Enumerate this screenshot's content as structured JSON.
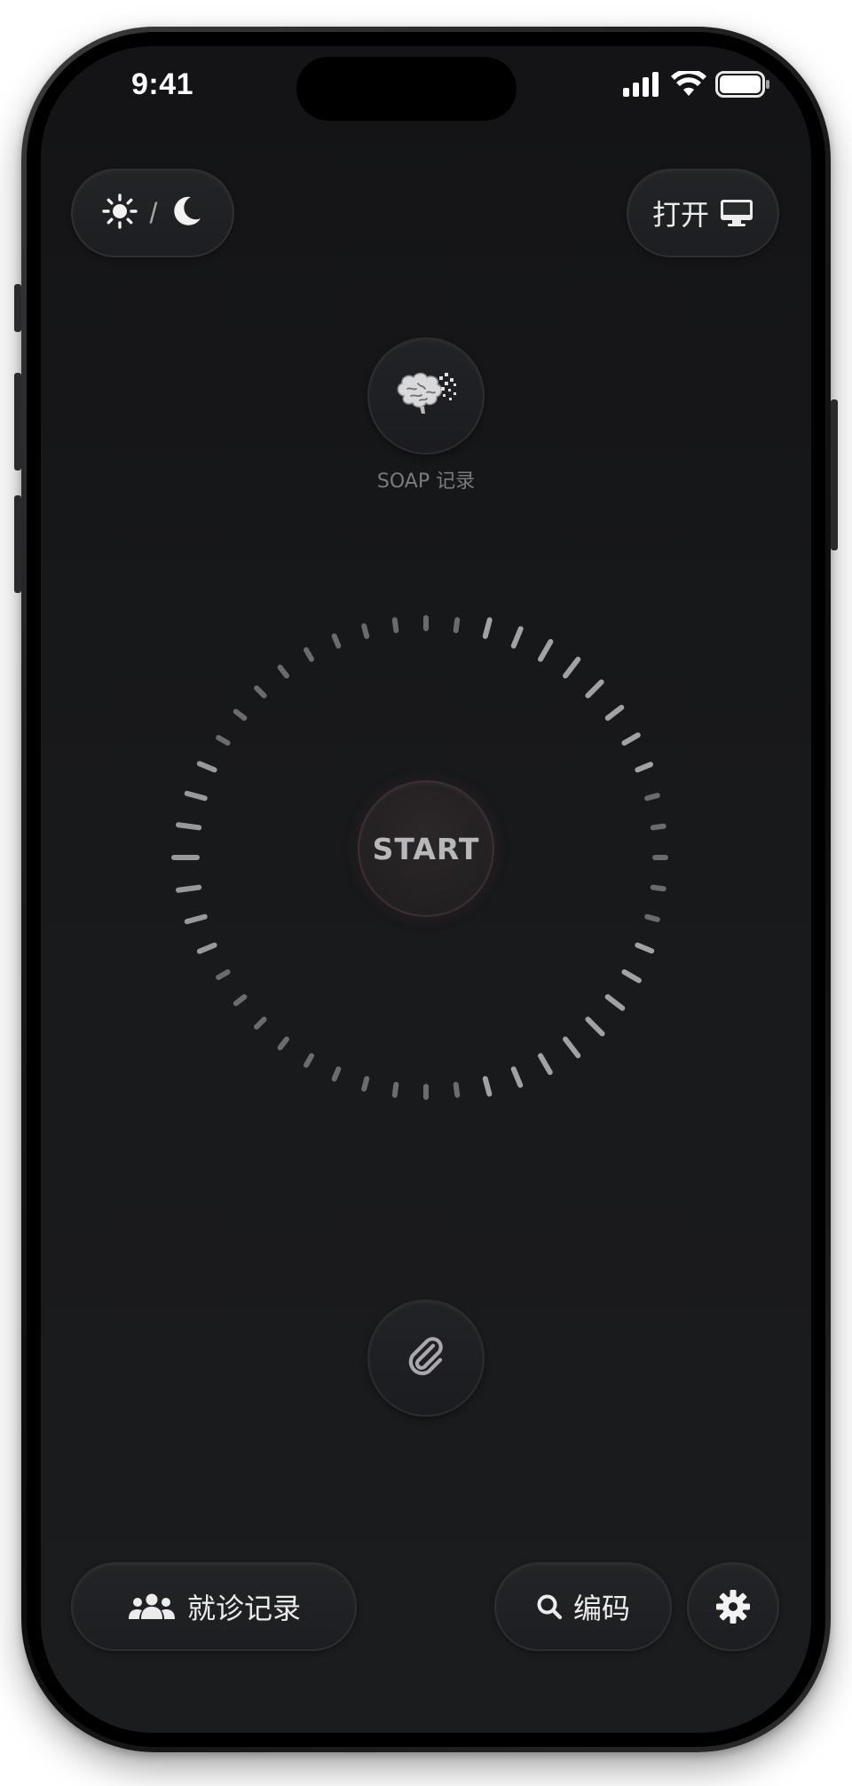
{
  "status_bar": {
    "time": "9:41",
    "icons": [
      "signal-icon",
      "wifi-icon",
      "battery-icon"
    ]
  },
  "top_bar": {
    "theme_toggle": {
      "separator": "/",
      "icons": [
        "sun-icon",
        "moon-icon"
      ]
    },
    "open_button": {
      "label": "打开",
      "icon": "monitor-icon"
    }
  },
  "soap": {
    "icon": "brain-icon",
    "label": "SOAP 记录"
  },
  "recorder": {
    "start_label": "START"
  },
  "attachment": {
    "icon": "paperclip-icon"
  },
  "bottom_bar": {
    "records_button": {
      "label": "就诊记录",
      "icon": "users-icon"
    },
    "code_button": {
      "label": "编码",
      "icon": "search-icon"
    },
    "settings_button": {
      "icon": "gear-icon"
    }
  },
  "colors": {
    "screen_background": "#18191b",
    "accent_start_border": "#3d2e33",
    "text_primary": "#ececed",
    "text_muted": "#7a7b7f"
  }
}
